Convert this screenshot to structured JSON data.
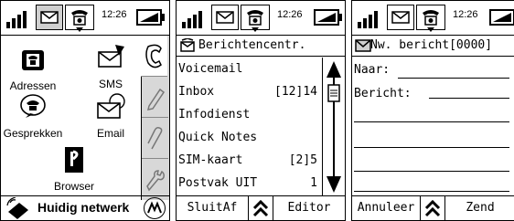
{
  "status": {
    "time": "12:26"
  },
  "home": {
    "apps": [
      {
        "id": "adressen",
        "label": "Adressen"
      },
      {
        "id": "sms",
        "label": "SMS"
      },
      {
        "id": "gesprekken",
        "label": "Gesprekken"
      },
      {
        "id": "email",
        "label": "Email"
      },
      {
        "id": "browser",
        "label": "Browser"
      }
    ],
    "network_label": "Huidig netwerk"
  },
  "messages": {
    "title": "Berichtencentr.",
    "items": [
      {
        "name": "Voicemail",
        "count": ""
      },
      {
        "name": "Inbox",
        "count": "[12]14"
      },
      {
        "name": "Infodienst",
        "count": ""
      },
      {
        "name": "Quick Notes",
        "count": ""
      },
      {
        "name": "SIM-kaart",
        "count": "[2]5"
      },
      {
        "name": "Postvak UIT",
        "count": "1"
      }
    ],
    "left_softkey": "SluitAf",
    "right_softkey": "Editor"
  },
  "compose": {
    "title": "Nw. bericht[0000]",
    "to_label": "Naar:",
    "message_label": "Bericht:",
    "left_softkey": "Annuleer",
    "right_softkey": "Zend"
  }
}
